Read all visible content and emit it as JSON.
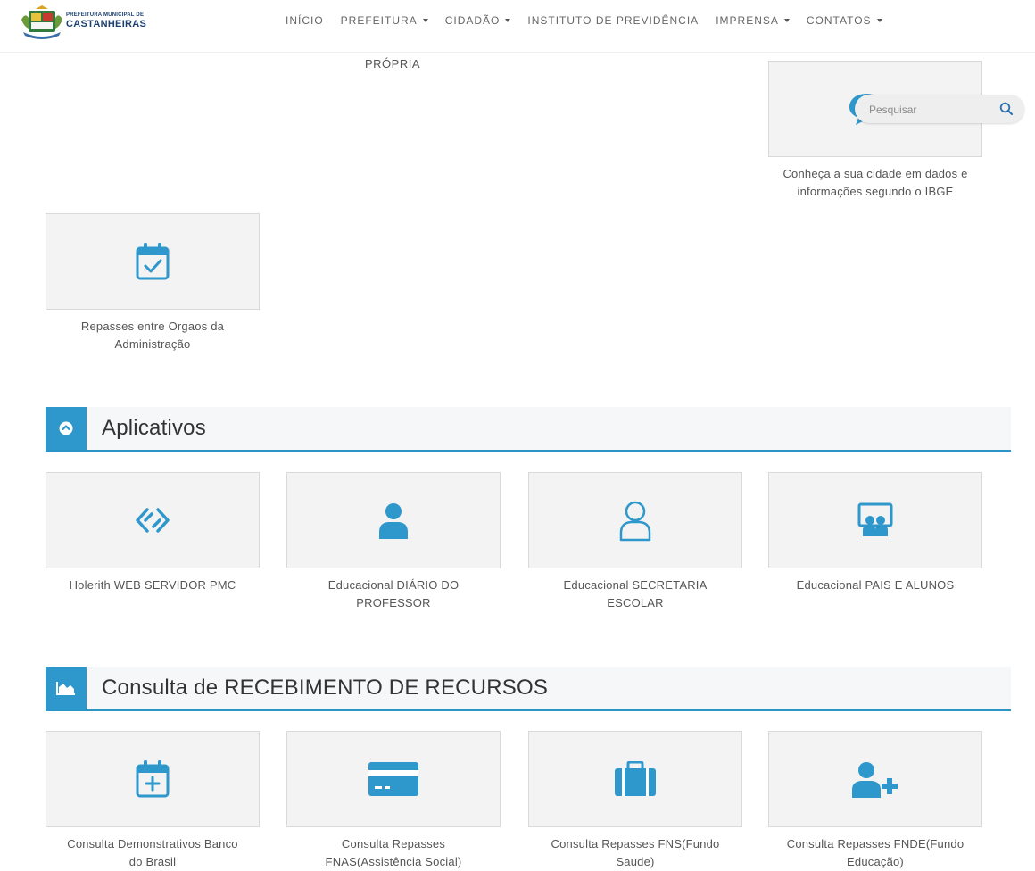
{
  "header": {
    "logo_line1": "PREFEITURA MUNICIPAL DE",
    "logo_line2": "CASTANHEIRAS",
    "nav": [
      {
        "label": "INÍCIO"
      },
      {
        "label": "PREFEITURA"
      },
      {
        "label": "CIDADÃO"
      },
      {
        "label": "INSTITUTO DE PREVIDÊNCIA"
      },
      {
        "label": "IMPRENSA"
      },
      {
        "label": "CONTATOS"
      }
    ]
  },
  "search": {
    "placeholder": "Pesquisar"
  },
  "top": {
    "propria_label": "PRÓPRIA",
    "ibge_label_1": "Conheça a sua cidade em dados e",
    "ibge_label_2": "informações segundo o IBGE",
    "repasses_label_1": "Repasses entre Orgaos da",
    "repasses_label_2": "Administração"
  },
  "aplicativos": {
    "title": "Aplicativos",
    "cards": [
      {
        "line1": "Holerith WEB SERVIDOR PMC",
        "line2": ""
      },
      {
        "line1": "Educacional DIÁRIO DO",
        "line2": "PROFESSOR"
      },
      {
        "line1": "Educacional SECRETARIA",
        "line2": "ESCOLAR"
      },
      {
        "line1": "Educacional PAIS E ALUNOS",
        "line2": ""
      }
    ]
  },
  "recursos": {
    "title": "Consulta de RECEBIMENTO DE RECURSOS",
    "cards": [
      {
        "line1": "Consulta Demonstrativos Banco",
        "line2": "do Brasil"
      },
      {
        "line1": "Consulta Repasses",
        "line2": "FNAS(Assistência Social)"
      },
      {
        "line1": "Consulta Repasses FNS(Fundo",
        "line2": "Saude)"
      },
      {
        "line1": "Consulta Repasses FNDE(Fundo",
        "line2": "Educação)"
      }
    ]
  },
  "colors": {
    "accent": "#2e97cc",
    "card_bg": "#f3f3f3",
    "section_bg": "#f6f7f8"
  }
}
